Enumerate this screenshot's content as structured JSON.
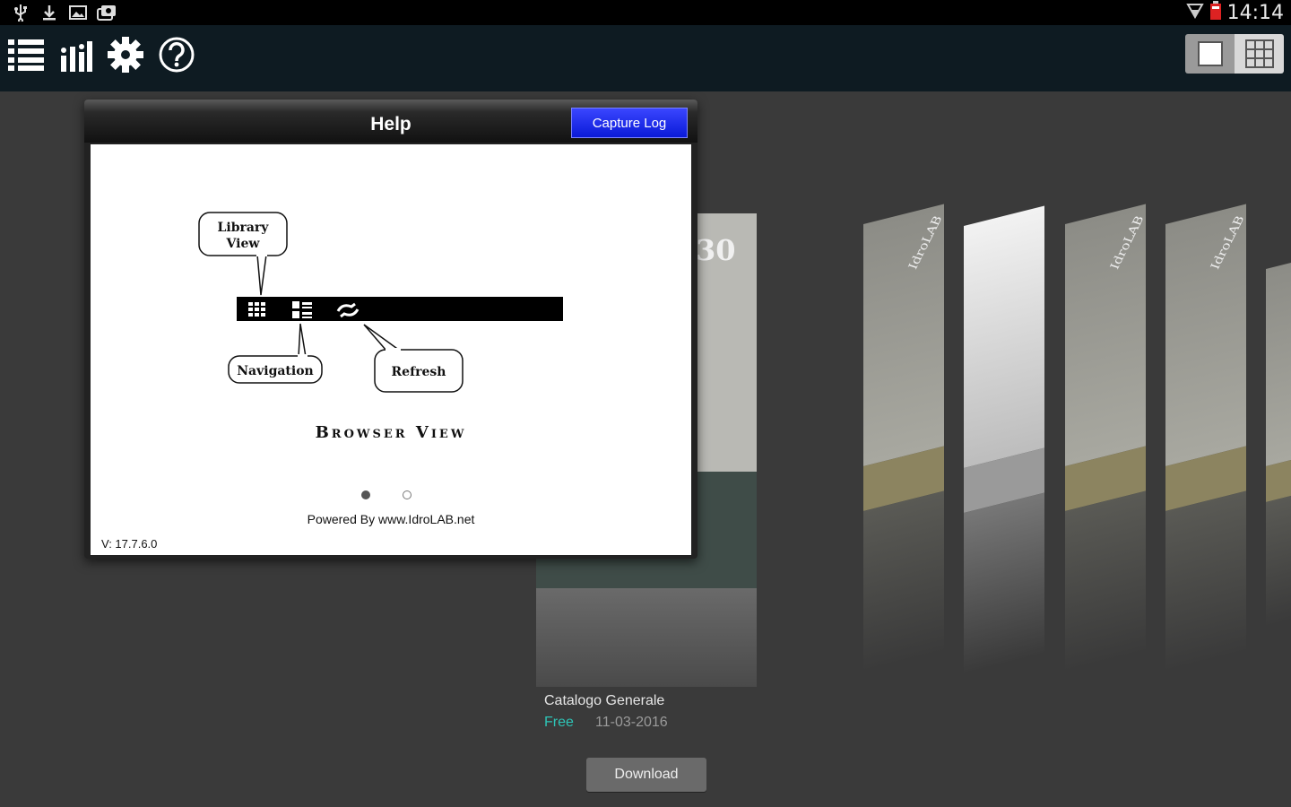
{
  "status_bar": {
    "time": "14:14",
    "left_icons": [
      "usb-icon",
      "download-icon",
      "image-icon",
      "photos-icon"
    ],
    "right_icons": [
      "wifi-icon",
      "battery-icon"
    ]
  },
  "action_bar": {
    "buttons": [
      "list-icon",
      "equalizer-icon",
      "gear-icon",
      "help-icon"
    ],
    "view_toggle": [
      "single-view-icon",
      "grid-view-icon"
    ]
  },
  "help_dialog": {
    "title": "Help",
    "capture_button": "Capture Log",
    "diagram": {
      "library_view_line1": "Library",
      "library_view_line2": "View",
      "navigation": "Navigation",
      "refresh": "Refresh"
    },
    "caption": "Browser View",
    "pager": {
      "total": 2,
      "active": 1
    },
    "powered_by": "Powered By www.IdroLAB.net",
    "version": "V: 17.7.6.0"
  },
  "main_cover": {
    "top_text": "30",
    "title": "Catalogo Generale",
    "price": "Free",
    "date": "11-03-2016",
    "download_label": "Download"
  },
  "side_covers": [
    {
      "brand": "IdroLAB"
    },
    {
      "brand": ""
    },
    {
      "brand": "IdroLAB"
    },
    {
      "brand": "IdroLAB"
    }
  ],
  "colors": {
    "background": "#3a3a3a",
    "action_bar": "#0e1b22",
    "capture_button": "#1a2cf0",
    "free_text": "#2ec4b6"
  }
}
